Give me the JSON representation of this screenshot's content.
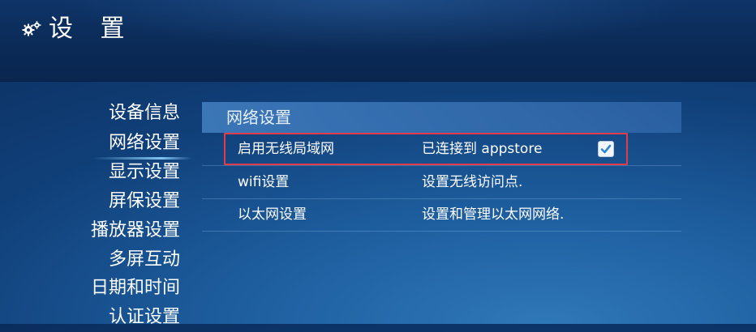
{
  "header": {
    "title": "设 置",
    "icon": "gears-icon"
  },
  "sidebar": {
    "items": [
      {
        "label": "设备信息",
        "active": false
      },
      {
        "label": "网络设置",
        "active": true
      },
      {
        "label": "显示设置",
        "active": false
      },
      {
        "label": "屏保设置",
        "active": false
      },
      {
        "label": "播放器设置",
        "active": false
      },
      {
        "label": "多屏互动",
        "active": false
      },
      {
        "label": "日期和时间",
        "active": false
      },
      {
        "label": "认证设置",
        "active": false
      }
    ]
  },
  "panel": {
    "section_title": "网络设置",
    "rows": [
      {
        "label": "启用无线局域网",
        "value": "已连接到 appstore",
        "checked": true
      },
      {
        "label": "wifi设置",
        "value": "设置无线访问点."
      },
      {
        "label": "以太网设置",
        "value": "设置和管理以太网网络."
      }
    ]
  },
  "colors": {
    "highlight_border": "#e23b4a",
    "checkbox_check": "#2f86d6",
    "background": "#103f78"
  }
}
